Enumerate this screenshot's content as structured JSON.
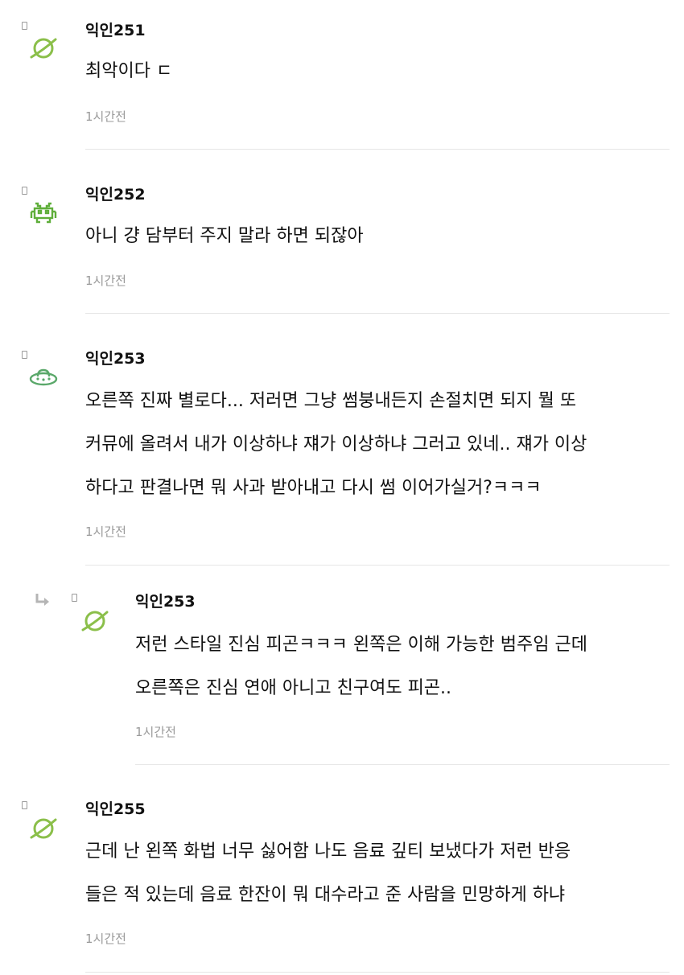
{
  "comments": [
    {
      "nickname": "익인251",
      "avatar_icon": "planet-icon",
      "lines": [
        "최악이다 ㄷ"
      ],
      "time": "1시간전"
    },
    {
      "nickname": "익인252",
      "avatar_icon": "space-invader-icon",
      "lines": [
        "아니 걍 담부터 주지 말라 하면 되잖아"
      ],
      "time": "1시간전"
    },
    {
      "nickname": "익인253",
      "avatar_icon": "ufo-icon",
      "lines": [
        "오른쪽 진짜 별로다... 저러면 그냥 썸붕내든지 손절치면 되지 뭘 또",
        "커뮤에 올려서 내가 이상하냐 쟤가 이상하냐 그러고 있네.. 쟤가 이상",
        "하다고 판결나면 뭐 사과 받아내고 다시 썸 이어가실거?ㅋㅋㅋ"
      ],
      "time": "1시간전"
    },
    {
      "nickname": "익인253",
      "avatar_icon": "planet-icon",
      "is_reply": true,
      "reply_icon": "reply-arrow-icon",
      "lines": [
        "저런 스타일 진심 피곤ㅋㅋㅋ 왼쪽은 이해 가능한 범주임 근데",
        "오른쪽은 진심 연애 아니고 친구여도 피곤.."
      ],
      "time": "1시간전"
    },
    {
      "nickname": "익인255",
      "avatar_icon": "planet-icon",
      "lines": [
        "근데 난 왼쪽 화법 너무 싫어함 나도 음료 깊티 보냈다가 저런 반응",
        "들은 적 있는데 음료 한잔이 뭐 대수라고 준 사람을 민망하게 하냐"
      ],
      "time": "1시간전"
    }
  ],
  "colors": {
    "avatar_green": "#8bbf4a",
    "invader_green": "#5fae3a",
    "ufo_green": "#5aa86a",
    "time_gray": "#9a9a9a",
    "divider": "#e6e6e6"
  }
}
